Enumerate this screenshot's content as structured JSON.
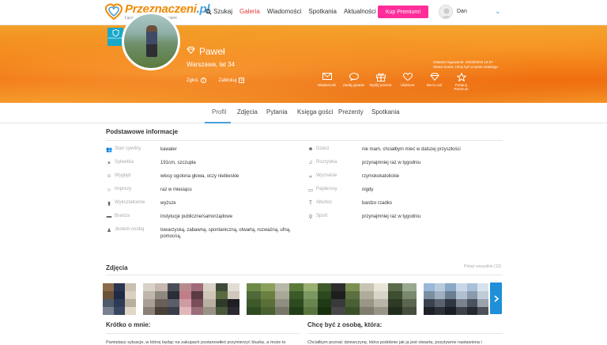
{
  "header": {
    "logo_title": "Przeznaczeni",
    "logo_tld": ".pl",
    "logo_subtitle": "Łączymy Ludzi z Wartościami",
    "nav": [
      {
        "label": "Szukaj",
        "icon": "search-icon"
      },
      {
        "label": "Galeria",
        "active": true
      },
      {
        "label": "Wiadomości"
      },
      {
        "label": "Spotkania"
      },
      {
        "label": "Aktualności"
      }
    ],
    "premium_label": "Kup Premium!",
    "user_name": "Dan",
    "accent_color": "#f08a00",
    "premium_color": "#ff2d9a"
  },
  "profile": {
    "badge_label": "Zaufany profil",
    "name": "Paweł",
    "location_age": "Warszawa, lat 34",
    "report_label": "Zgłoś",
    "block_label": "Zablokuj",
    "last_login": "Ostatnie logowanie: 2023/03/18 14:07",
    "account_status": "Status konta: Chcę być w twoim katalogu"
  },
  "banner_actions": [
    {
      "label": "Wiadomość",
      "icon": "envelope-icon"
    },
    {
      "label": "Zadaj pytanie",
      "icon": "chat-bubble-icon"
    },
    {
      "label": "Wyślij prezent",
      "icon": "gift-icon"
    },
    {
      "label": "Ulubione",
      "icon": "heart-icon"
    },
    {
      "label": "Ma to coś",
      "icon": "diamond-icon"
    },
    {
      "label": "Podaruj Premium",
      "icon": "star-icon"
    }
  ],
  "tabs": [
    {
      "label": "Profil",
      "active": true
    },
    {
      "label": "Zdjęcia"
    },
    {
      "label": "Pytania"
    },
    {
      "label": "Księga gości"
    },
    {
      "label": "Prezenty"
    },
    {
      "label": "Spotkania"
    }
  ],
  "basic_info": {
    "title": "Podstawowe informacje",
    "left": [
      {
        "label": "Stan cywilny",
        "value": "kawaler",
        "icon": "people-icon"
      },
      {
        "label": "Sylwetka",
        "value": "191cm, szczupła",
        "icon": "body-icon"
      },
      {
        "label": "Wygląd",
        "value": "włosy ogolona głowa, oczy niebieskie",
        "icon": "face-icon"
      },
      {
        "label": "Imprezy",
        "value": "raz w miesiącu",
        "icon": "star-outline-icon"
      },
      {
        "label": "Wykształcenie",
        "value": "wyższe",
        "icon": "book-icon"
      },
      {
        "label": "Branża",
        "value": "instytucje publiczne/samorządowe",
        "icon": "briefcase-icon"
      },
      {
        "label": "Jestem osobą",
        "value": "towarzyską, zabawną, spontaniczną, otwartą, rozważną, ufną, pomocną,",
        "icon": "person-icon"
      }
    ],
    "right": [
      {
        "label": "Dzieci",
        "value": "nie mam, chciałbym mieć w dalszej przyszłości",
        "icon": "child-icon"
      },
      {
        "label": "Rozrywka",
        "value": "przynajmniej raz w tygodniu",
        "icon": "music-note-icon"
      },
      {
        "label": "Wyznanie",
        "value": "rzymskokatolickie",
        "icon": "fish-icon"
      },
      {
        "label": "Papierosy",
        "value": "nigdy",
        "icon": "cigarette-icon"
      },
      {
        "label": "Alkohol",
        "value": "bardzo rzadko",
        "icon": "glass-icon"
      },
      {
        "label": "Sport",
        "value": "przynajmniej raz w tygodniu",
        "icon": "dumbbell-icon"
      }
    ]
  },
  "photos": {
    "title": "Zdjęcia",
    "show_all": "Pokaż wszystkie (12)"
  },
  "about": {
    "title": "Krótko o mnie:",
    "text": "Pamiętasz sytuacje, w której będąc na zakupach postanowiłeś przymierzyć bluzkę, a może to"
  },
  "looking_for": {
    "title": "Chcę być z osobą, która:",
    "text": "Chciałbym poznać dziewczynę, która podobnie jak ja jest otwarta, pozytywnie nastawiona i"
  }
}
